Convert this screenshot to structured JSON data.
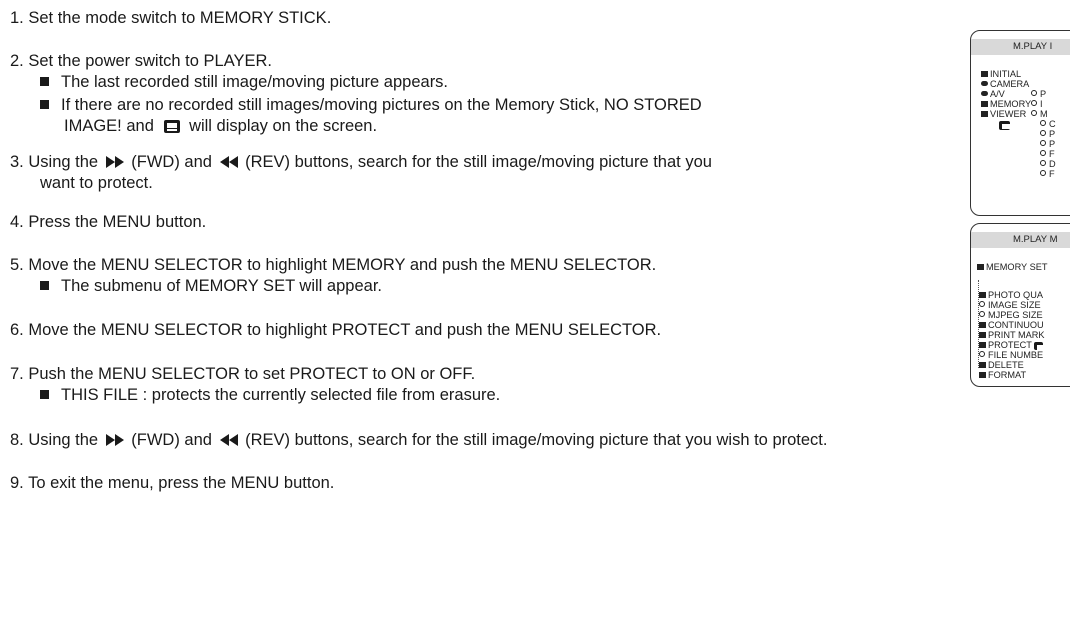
{
  "steps": [
    {
      "num": "1.",
      "text": "Set the mode switch to MEMORY STICK."
    },
    {
      "num": "2.",
      "text": "Set the power switch to PLAYER."
    },
    {
      "num": "3.",
      "pre": "Using the",
      "fwd": "(FWD) and",
      "rev": "(REV) buttons, search for the still image/moving picture that you",
      "cont": "want to protect."
    },
    {
      "num": "4.",
      "text": "Press the MENU button."
    },
    {
      "num": "5.",
      "text": "Move the MENU SELECTOR to highlight MEMORY and push the MENU SELECTOR."
    },
    {
      "num": "6.",
      "text": "Move the MENU SELECTOR to highlight PROTECT and push the MENU SELECTOR."
    },
    {
      "num": "7.",
      "text": "Push the MENU SELECTOR to set PROTECT to ON or OFF."
    },
    {
      "num": "8.",
      "pre": "Using the",
      "fwd": "(FWD) and",
      "rev": "(REV) buttons, search for the still image/moving picture that you wish to protect."
    },
    {
      "num": "9.",
      "text": "To exit the menu, press the MENU button."
    }
  ],
  "bullets": {
    "b2a": "The last recorded still image/moving picture appears.",
    "b2b_1": "If there are no recorded still images/moving pictures on the Memory Stick, NO STORED",
    "b2b_2a": "IMAGE! and",
    "b2b_2b": "will display on the screen.",
    "b5": "The submenu of MEMORY SET will appear.",
    "b7": "THIS FILE : protects the currently selected file from erasure."
  },
  "panel1": {
    "title": "M.PLAY I",
    "items": [
      "INITIAL",
      "CAMERA",
      "A/V",
      "MEMORY",
      "VIEWER"
    ],
    "sub": [
      "P",
      "I",
      "M",
      "C",
      "P",
      "P",
      "F",
      "D",
      "F"
    ]
  },
  "panel2": {
    "title": "M.PLAY M",
    "header": "MEMORY SET",
    "items": [
      "PHOTO QUA",
      "IMAGE SIZE",
      "MJPEG SIZE",
      "CONTINUOU",
      "PRINT MARK",
      "PROTECT",
      "FILE NUMBE",
      "DELETE",
      "FORMAT"
    ]
  },
  "icons": [
    "fast-forward-icon",
    "rewind-icon",
    "memory-stick-icon",
    "folder-icon",
    "camera-icon"
  ]
}
